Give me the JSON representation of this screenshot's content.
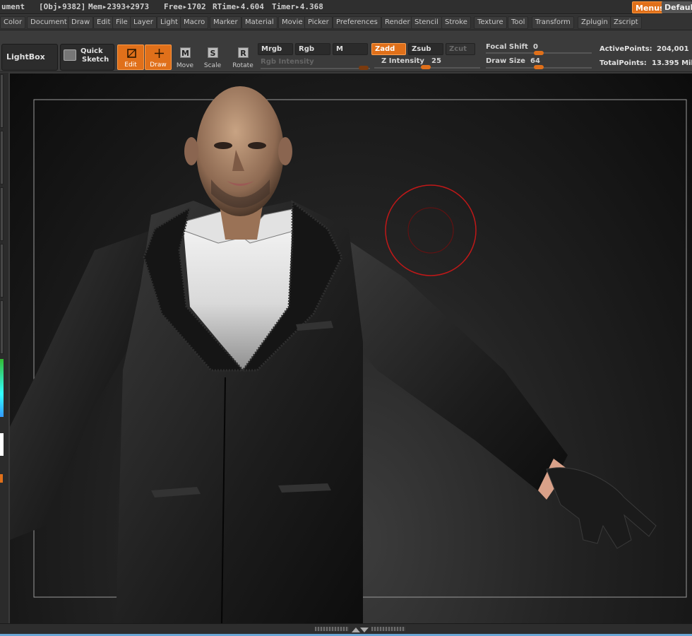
{
  "status": {
    "doc_fragment": "ument",
    "obj": "[Obj▸9382]",
    "mem": "Mem▸2393+2973",
    "free": "Free▸1702",
    "rtime": "RTime▸4.604",
    "timer": "Timer▸4.368",
    "menus_label": "Menus",
    "default_label": "Defaul"
  },
  "menu": [
    "Color",
    "Document",
    "Draw",
    "Edit",
    "File",
    "Layer",
    "Light",
    "Macro",
    "Marker",
    "Material",
    "Movie",
    "Picker",
    "Preferences",
    "Render",
    "Stencil",
    "Stroke",
    "Texture",
    "Tool",
    "Transform",
    "Zplugin",
    "Zscript"
  ],
  "shelf": {
    "lightbox": "LightBox",
    "quick_sketch_1": "Quick",
    "quick_sketch_2": "Sketch",
    "edit": "Edit",
    "draw": "Draw",
    "move": "Move",
    "scale": "Scale",
    "rotate": "Rotate",
    "move_key": "M",
    "scale_key": "S",
    "rotate_key": "R",
    "mrgb": "Mrgb",
    "rgb": "Rgb",
    "m": "M",
    "rgb_intensity": "Rgb Intensity",
    "zadd": "Zadd",
    "zsub": "Zsub",
    "zcut": "Zcut",
    "z_intensity_label": "Z Intensity",
    "z_intensity": "25",
    "focal_shift_label": "Focal Shift",
    "focal_shift": "0",
    "draw_size_label": "Draw Size",
    "draw_size": "64",
    "active_points_label": "ActivePoints:",
    "active_points": "204,001",
    "total_points_label": "TotalPoints:",
    "total_points": "13.395 Mil"
  },
  "colors": {
    "accent": "#e0701a",
    "brush_cursor": "#c01818"
  }
}
